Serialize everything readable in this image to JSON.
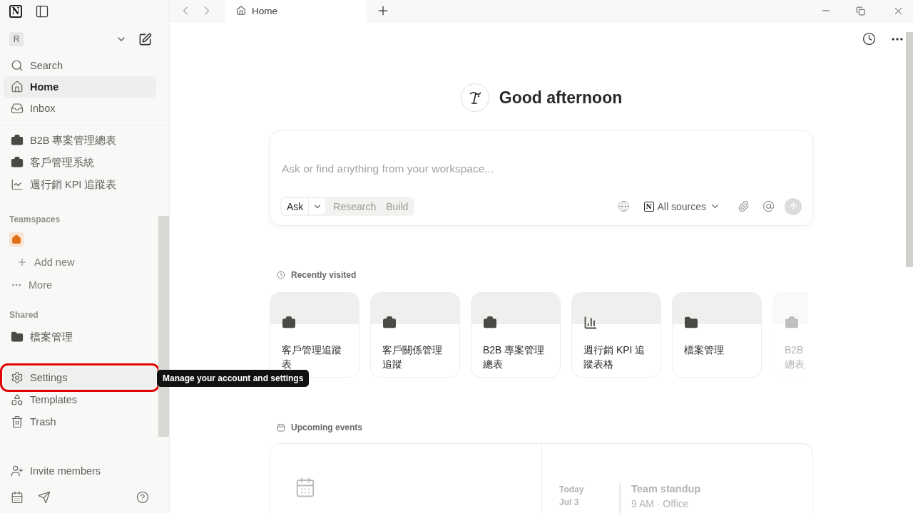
{
  "sidebar": {
    "logo": "N",
    "workspace": {
      "initial": "R"
    },
    "nav": [
      {
        "label": "Search",
        "selected": false
      },
      {
        "label": "Home",
        "selected": true
      },
      {
        "label": "Inbox",
        "selected": false
      }
    ],
    "pages": [
      {
        "label": "B2B 專案管理總表",
        "kind": "project"
      },
      {
        "label": "客戶管理系統",
        "kind": "project"
      },
      {
        "label": "週行銷 KPI 追蹤表",
        "kind": "report"
      }
    ],
    "teamspaces": {
      "heading": "Teamspaces",
      "actions": [
        {
          "label": "Add new"
        },
        {
          "label": "More"
        }
      ]
    },
    "shared": {
      "heading": "Shared",
      "items": [
        {
          "label": "檔案管理",
          "kind": "folder"
        }
      ]
    },
    "tools": [
      {
        "label": "Settings",
        "highlighted": true
      },
      {
        "label": "Templates",
        "highlighted": false
      },
      {
        "label": "Trash",
        "highlighted": false
      }
    ],
    "invite": {
      "label": "Invite members"
    }
  },
  "tooltip": {
    "text": "Manage your account and settings"
  },
  "tabs": [
    {
      "label": "Home",
      "selected": true
    }
  ],
  "greeting": "Good afternoon",
  "ask": {
    "placeholder": "Ask or find anything from your workspace...",
    "modes": [
      {
        "label": "Ask",
        "selected": true
      },
      {
        "label": "Research",
        "selected": false
      },
      {
        "label": "Build",
        "selected": false
      }
    ],
    "source_logo": "N",
    "sources": "All sources"
  },
  "recent": {
    "heading": "Recently visited",
    "cards": [
      {
        "lines": [
          "客戶管理追蹤",
          "表"
        ],
        "kind": "project",
        "faded": false
      },
      {
        "lines": [
          "客戶關係管理",
          "追蹤"
        ],
        "kind": "project",
        "faded": false
      },
      {
        "lines": [
          "B2B 專案管理",
          "總表"
        ],
        "kind": "project",
        "faded": false
      },
      {
        "lines": [
          "週行銷 KPI 追",
          "蹤表格"
        ],
        "kind": "report",
        "faded": false
      },
      {
        "lines": [
          "檔案管理"
        ],
        "kind": "folder",
        "faded": false
      },
      {
        "lines": [
          "B2B",
          "總表"
        ],
        "kind": "project",
        "faded": true
      }
    ]
  },
  "events": {
    "heading": "Upcoming events",
    "day": "Today",
    "date": "Jul 3",
    "title": "Team standup",
    "detail": "9 AM · Office"
  }
}
